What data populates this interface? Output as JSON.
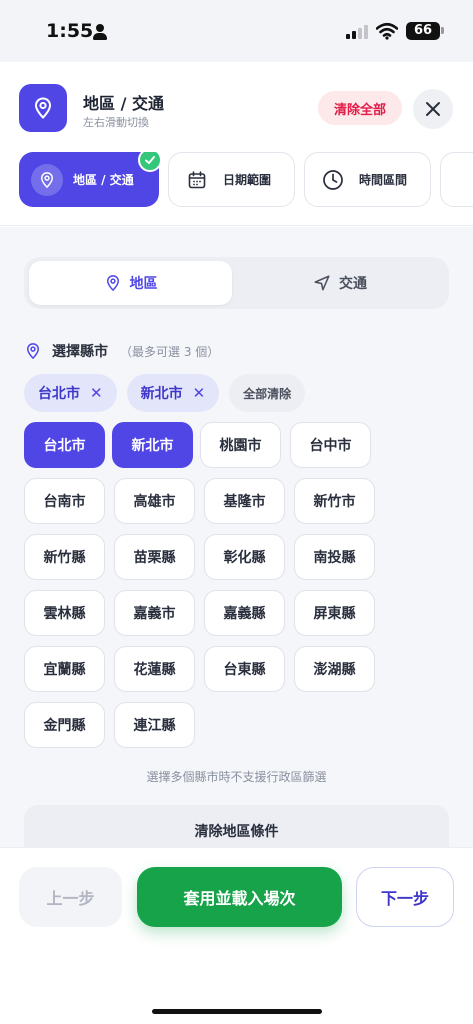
{
  "status_bar": {
    "time": "1:55",
    "battery": "66"
  },
  "header": {
    "title": "地區 / 交通",
    "subtitle": "左右滑動切換",
    "clear_all_label": "清除全部"
  },
  "steps": [
    {
      "label": "地區 / 交通",
      "icon": "map-pin-icon",
      "active": true,
      "completed": true
    },
    {
      "label": "日期範圍",
      "icon": "calendar-icon",
      "active": false
    },
    {
      "label": "時間區間",
      "icon": "clock-icon",
      "active": false
    }
  ],
  "segment": {
    "region_label": "地區",
    "transport_label": "交通",
    "active": "region"
  },
  "city_section": {
    "title": "選擇縣市",
    "hint": "（最多可選 3 個）",
    "selected": [
      "台北市",
      "新北市"
    ],
    "clear_all_chip": "全部清除",
    "cities": [
      "台北市",
      "新北市",
      "桃園市",
      "台中市",
      "台南市",
      "高雄市",
      "基隆市",
      "新竹市",
      "新竹縣",
      "苗栗縣",
      "彰化縣",
      "南投縣",
      "雲林縣",
      "嘉義市",
      "嘉義縣",
      "屏東縣",
      "宜蘭縣",
      "花蓮縣",
      "台東縣",
      "澎湖縣",
      "金門縣",
      "連江縣"
    ],
    "note": "選擇多個縣市時不支援行政區篩選",
    "clear_region_label": "清除地區條件"
  },
  "footer": {
    "prev_label": "上一步",
    "apply_label": "套用並載入場次",
    "next_label": "下一步"
  },
  "colors": {
    "primary": "#4f46e5",
    "success": "#16a34a",
    "danger": "#e11d48"
  }
}
